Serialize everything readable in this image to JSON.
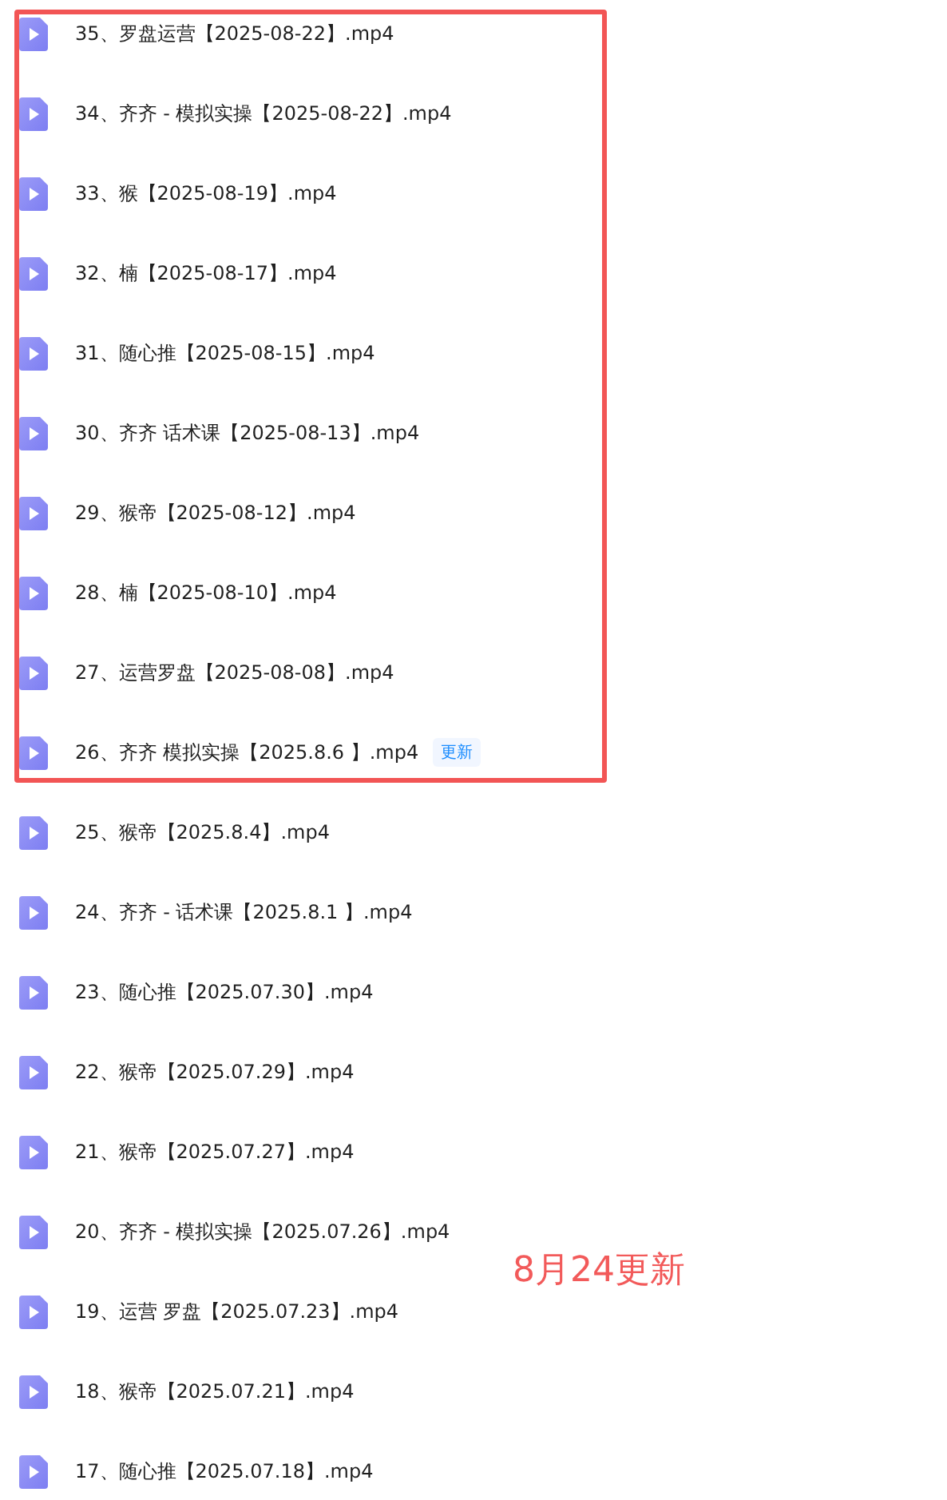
{
  "highlighted_files": [
    {
      "name": "35、罗盘运营【2025-08-22】.mp4"
    },
    {
      "name": "34、齐齐 - 模拟实操【2025-08-22】.mp4"
    },
    {
      "name": "33、猴【2025-08-19】.mp4"
    },
    {
      "name": "32、楠【2025-08-17】.mp4"
    },
    {
      "name": "31、随心推【2025-08-15】.mp4"
    },
    {
      "name": "30、齐齐 话术课【2025-08-13】.mp4"
    },
    {
      "name": "29、猴帝【2025-08-12】.mp4"
    },
    {
      "name": "28、楠【2025-08-10】.mp4"
    },
    {
      "name": "27、运营罗盘【2025-08-08】.mp4"
    },
    {
      "name": "26、齐齐 模拟实操【2025.8.6 】.mp4",
      "badge": "更新"
    }
  ],
  "files": [
    {
      "name": "25、猴帝【2025.8.4】.mp4"
    },
    {
      "name": "24、齐齐 - 话术课【2025.8.1 】.mp4"
    },
    {
      "name": "23、随心推【2025.07.30】.mp4"
    },
    {
      "name": "22、猴帝【2025.07.29】.mp4"
    },
    {
      "name": "21、猴帝【2025.07.27】.mp4"
    },
    {
      "name": "20、齐齐 - 模拟实操【2025.07.26】.mp4"
    },
    {
      "name": "19、运营 罗盘【2025.07.23】.mp4"
    },
    {
      "name": "18、猴帝【2025.07.21】.mp4"
    },
    {
      "name": "17、随心推【2025.07.18】.mp4"
    }
  ],
  "annotation": "8月24更新"
}
